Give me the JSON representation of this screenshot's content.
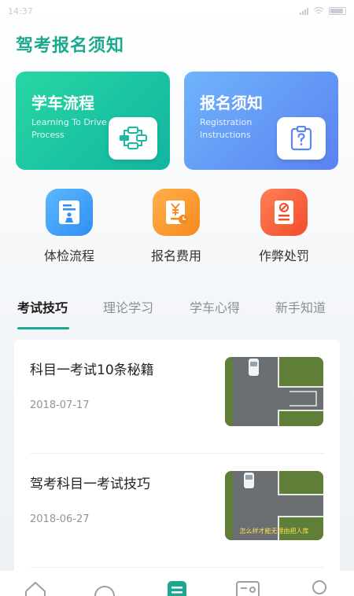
{
  "status_bar": {
    "time": "14:37"
  },
  "page_title": "驾考报名须知",
  "cards": [
    {
      "title": "学车流程",
      "subtitle": "Learning To Drive Process",
      "icon": "flowchart-icon",
      "accent": "#1db8a0"
    },
    {
      "title": "报名须知",
      "subtitle": "Registration Instructions",
      "icon": "clipboard-question-icon",
      "accent": "#5d86f2"
    }
  ],
  "features": [
    {
      "label": "体检流程",
      "icon": "medical-exam-icon",
      "color": "#2f8ef5"
    },
    {
      "label": "报名费用",
      "icon": "fee-receipt-icon",
      "color": "#f58a1f"
    },
    {
      "label": "作弊处罚",
      "icon": "penalty-document-icon",
      "color": "#f24c2b"
    }
  ],
  "tabs": [
    {
      "label": "考试技巧",
      "active": true
    },
    {
      "label": "理论学习",
      "active": false
    },
    {
      "label": "学车心得",
      "active": false
    },
    {
      "label": "新手知道",
      "active": false
    }
  ],
  "articles": [
    {
      "title": "科目一考试10条秘籍",
      "date": "2018-07-17",
      "thumbnail": "driving-test-course-image"
    },
    {
      "title": "驾考科目一考试技巧",
      "date": "2018-06-27",
      "thumbnail": "driving-test-course-image",
      "thumbnail_caption": "怎么样才能无理由把人库"
    }
  ],
  "bottom_nav": [
    {
      "icon": "home-icon"
    },
    {
      "icon": "chat-bubble-icon"
    },
    {
      "icon": "list-icon",
      "active": true
    },
    {
      "icon": "id-card-icon"
    },
    {
      "icon": "profile-icon"
    }
  ],
  "colors": {
    "brand": "#1aa98e",
    "active_tab_underline": "#1aa98e"
  }
}
